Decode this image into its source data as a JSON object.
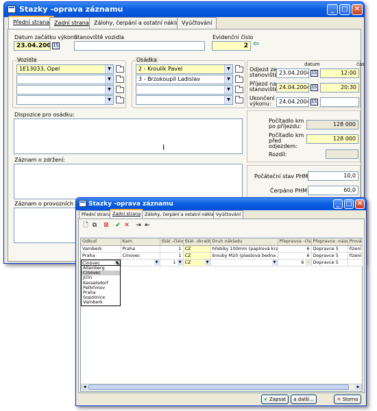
{
  "main": {
    "title": "Stazky -oprava záznamu",
    "tabs": [
      "Přední strana",
      "Zadní strana",
      "Zálohy, čerpání a ostatní náklady",
      "Vyúčtování"
    ],
    "datum_zacatku_label": "Datum začátku výkonu",
    "datum_zacatku_value": "23.04.2004",
    "stanoviste_label": "Stanoviště vozidla",
    "stanoviste_value": "",
    "evidencni_label": "Evidenční číslo",
    "evidencni_value": "2",
    "vozidla_label": "Vozidla",
    "vozidla": [
      "1E13033, Opel",
      "",
      "",
      ""
    ],
    "osadka_label": "Osádka",
    "osadka": [
      "2 - Kroulík Pavel",
      "3 - Brzokoupil Ladislav",
      "",
      ""
    ],
    "datum_hdr": "datum",
    "cas_hdr": "čas",
    "odjezd_label": "Odjezd ze stanoviště:",
    "odjezd_datum": "23.04.2004",
    "odjezd_cas": "12:00",
    "prijezd_label": "Příjezd na stanoviště:",
    "prijezd_datum": "24.04.2004",
    "prijezd_cas": "20:30",
    "ukonceni_label": "Ukončení výkonu:",
    "ukonceni_datum": "24.04.2004",
    "ukonceni_cas": "",
    "dispozice_label": "Dispozice pro osádku:",
    "pocitadlo_prijezd_label": "Počítadlo km po příjezdu:",
    "pocitadlo_prijezd_value": "128 000",
    "pocitadlo_odjezd_label": "Počítadlo km před odjezdem:",
    "pocitadlo_odjezd_value": "128 000",
    "rozdil_label": "Rozdíl:",
    "rozdil_value": "",
    "zdrzeni_label": "Záznam o zdržení:",
    "pocatecni_label": "Počáteční stav PHM:",
    "pocatecni_value": "10,0",
    "cerpano_label": "Čerpáno PHM:",
    "cerpano_value": "60,0",
    "provoz_label": "Záznam o provozních pomě"
  },
  "overlay": {
    "title": "Stazky -oprava záznamu",
    "tabs": [
      "Přední strana",
      "Zadní strana",
      "Zálohy, čerpání a ostatní náklady",
      "Vyúčtování"
    ],
    "columns": [
      "Odkud",
      "Kam",
      "Stát -číslo",
      "Stát -zkratka",
      "Druh nákladu",
      "Přepravce -číslo",
      "Přepravce -název",
      "Provád"
    ],
    "rows": [
      [
        "Vamberk",
        "Praha",
        "1",
        "CZ",
        "hřebíky 100mm (papírová krabice ...",
        "6",
        "Dopravce 5",
        "řízení v"
      ],
      [
        "Praha",
        "Cinovec",
        "1",
        "CZ",
        "šrouby M20 (plastová bedna 20kg)",
        "6",
        "Dopravce 5",
        "řízení v"
      ]
    ],
    "edit_row": [
      "Cinovec",
      "",
      "1",
      "CZ",
      "",
      "6",
      "Dopravce 5",
      ""
    ],
    "dropdown": [
      "Altenberg",
      "Cinovec",
      "Jičín",
      "Kesselsdorf",
      "Pelhřimov",
      "Praha",
      "Sopotnice",
      "Vamberk"
    ],
    "dropdown_selected": "Cinovec",
    "btn_zapsat": "Zapsat",
    "btn_dalsi": "a další...",
    "btn_storno": "Storno"
  }
}
